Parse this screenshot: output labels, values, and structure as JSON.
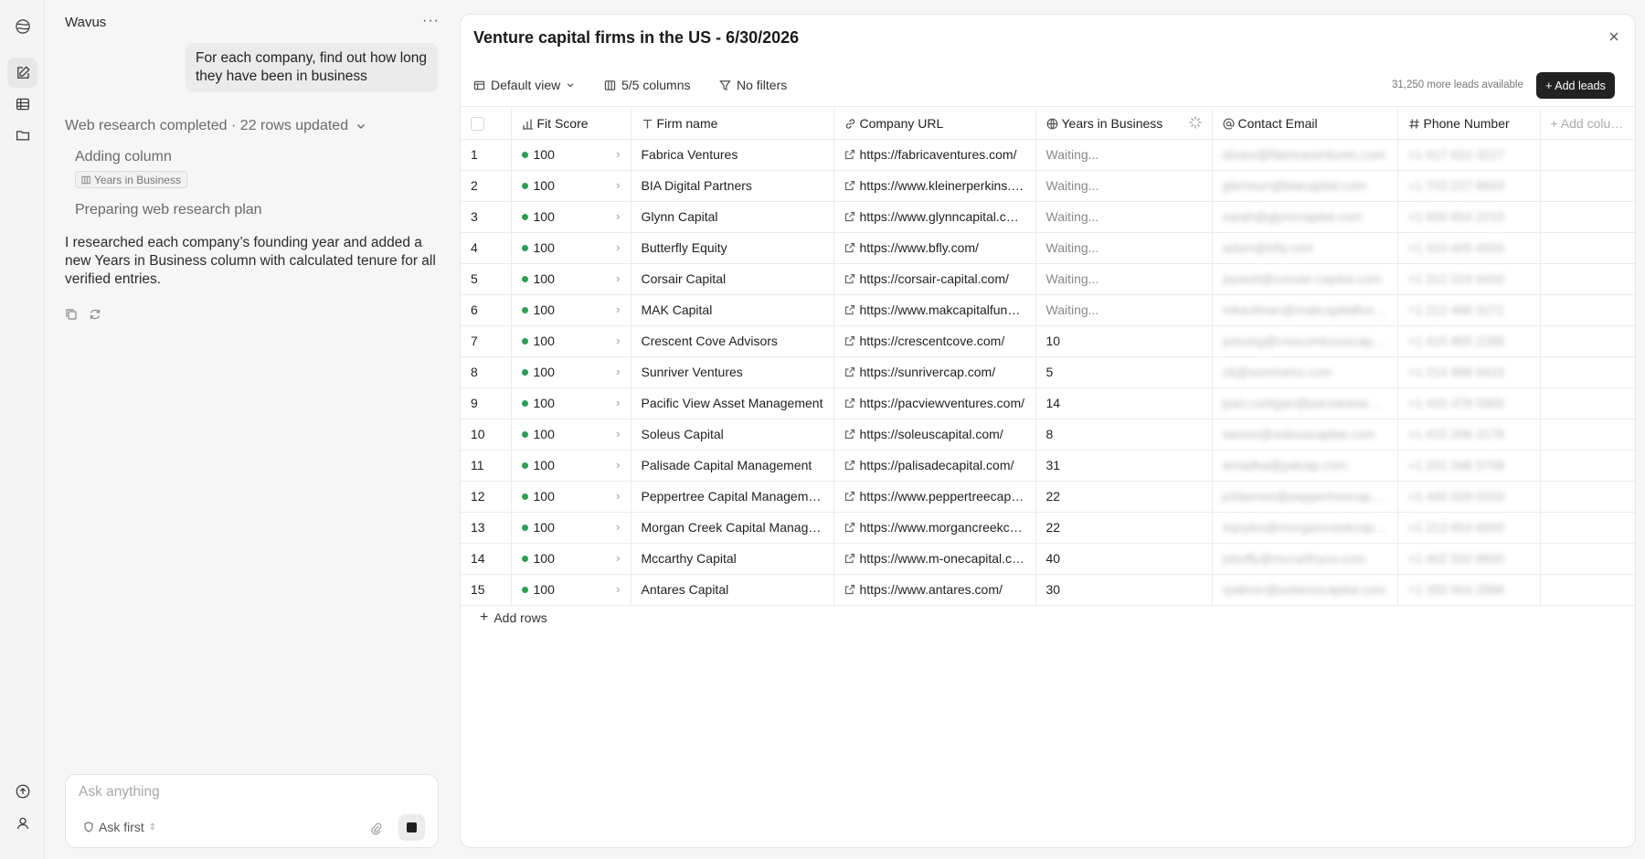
{
  "app": {
    "name": "Wavus"
  },
  "chat": {
    "title": "Wavus",
    "user_message": "For each company, find out how long they have been in business",
    "status": "Web research completed · 22 rows updated",
    "step_adding": "Adding column",
    "step_adding_chip": "Years in Business",
    "step_plan": "Preparing web research plan",
    "answer": "I researched each company’s founding year and added a new Years in Business column with calculated tenure for all verified entries.",
    "composer_placeholder": "Ask anything",
    "ask_mode": "Ask first"
  },
  "main": {
    "title": "Venture capital firms in the US - 6/30/2026",
    "view": "Default view",
    "columns_label": "5/5 columns",
    "filters_label": "No filters",
    "leads_available": "31,250 more leads available",
    "add_leads": "+ Add leads",
    "add_rows": "Add rows",
    "add_column": "Add column"
  },
  "table": {
    "headers": [
      "Fit Score",
      "Firm name",
      "Company URL",
      "Years in Business",
      "Contact Email",
      "Phone Number"
    ],
    "rows": [
      {
        "n": "1",
        "score": "100",
        "firm": "Fabrica Ventures",
        "url": "https://fabricaventures.com/",
        "years": "Waiting...",
        "email": "alvaro@fabricaventures.com",
        "phone": "+1 917 810 3227"
      },
      {
        "n": "2",
        "score": "100",
        "firm": "BIA Digital Partners",
        "url": "https://www.kleinerperkins.com/",
        "years": "Waiting...",
        "email": "gtemson@biacapital.com",
        "phone": "+1 703 227 8833"
      },
      {
        "n": "3",
        "score": "100",
        "firm": "Glynn Capital",
        "url": "https://www.glynncapital.com/",
        "years": "Waiting...",
        "email": "sarah@glynncapital.com",
        "phone": "+1 650 854 2215"
      },
      {
        "n": "4",
        "score": "100",
        "firm": "Butterfly Equity",
        "url": "https://www.bfly.com/",
        "years": "Waiting...",
        "email": "adam@bfly.com",
        "phone": "+1 310 405 4555"
      },
      {
        "n": "5",
        "score": "100",
        "firm": "Corsair Capital",
        "url": "https://corsair-capital.com/",
        "years": "Waiting...",
        "email": "jaywell@corsair-capital.com",
        "phone": "+1 212 224 9400"
      },
      {
        "n": "6",
        "score": "100",
        "firm": "MAK Capital",
        "url": "https://www.makcapitalfund.com/",
        "years": "Waiting...",
        "email": "mkaufman@makcapitalfund.com",
        "phone": "+1 212 486 3271"
      },
      {
        "n": "7",
        "score": "100",
        "firm": "Crescent Cove Advisors",
        "url": "https://crescentcove.com/",
        "years": "10",
        "email": "jsmong@crescentcovecap.com",
        "phone": "+1 415 800 2288"
      },
      {
        "n": "8",
        "score": "100",
        "firm": "Sunriver Ventures",
        "url": "https://sunrivercap.com/",
        "years": "5",
        "email": "cb@sunriverio.com",
        "phone": "+1 214 888 6418"
      },
      {
        "n": "9",
        "score": "100",
        "firm": "Pacific View Asset Management",
        "url": "https://pacviewventures.com/",
        "years": "14",
        "email": "joan.curtigan@pacviewasset.com",
        "phone": "+1 415 378 5900"
      },
      {
        "n": "10",
        "score": "100",
        "firm": "Soleus Capital",
        "url": "https://soleuscapital.com/",
        "years": "8",
        "email": "tsimon@soleuscapital.com",
        "phone": "+1 415 206 3178"
      },
      {
        "n": "11",
        "score": "100",
        "firm": "Palisade Capital Management",
        "url": "https://palisadecapital.com/",
        "years": "31",
        "email": "emadha@palcap.com",
        "phone": "+1 201 346 5758"
      },
      {
        "n": "12",
        "score": "100",
        "firm": "Peppertree Capital Management",
        "url": "https://www.peppertreecapital.com/",
        "years": "22",
        "email": "jcbleeves@peppertreecap.com",
        "phone": "+1 440 328 0333"
      },
      {
        "n": "13",
        "score": "100",
        "firm": "Morgan Creek Capital Management",
        "url": "https://www.morgancreekcap.com/",
        "years": "22",
        "email": "mjoyles@morgancreekcap.com",
        "phone": "+1 212 653 8900"
      },
      {
        "n": "14",
        "score": "100",
        "firm": "Mccarthy Capital",
        "url": "https://www.m-onecapital.com/",
        "years": "40",
        "email": "jsbuffy@mccarthyca.com",
        "phone": "+1 402 932 8600"
      },
      {
        "n": "15",
        "score": "100",
        "firm": "Antares Capital",
        "url": "https://www.antares.com/",
        "years": "30",
        "email": "rpalmer@antarescapital.com",
        "phone": "+1 300 604 2898"
      }
    ]
  },
  "colors": {
    "accent_dark": "#222222",
    "score_dot": "#2e9e57"
  }
}
